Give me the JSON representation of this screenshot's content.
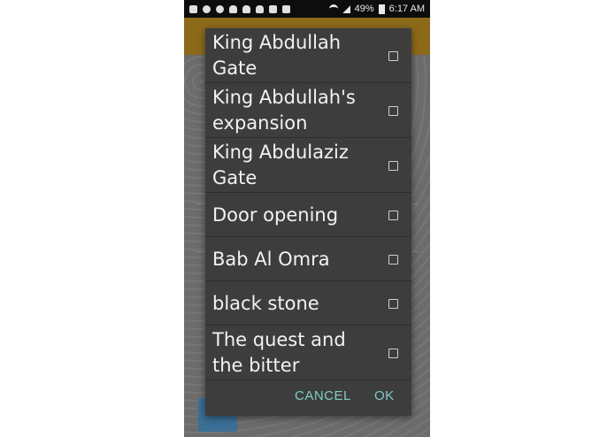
{
  "status_bar": {
    "icons": [
      "messaging-icon",
      "refresh-icon",
      "whatsapp-icon",
      "snapchat-icon",
      "snapchat-icon",
      "snapchat-icon",
      "image-icon",
      "clipboard-icon"
    ],
    "battery": "49%",
    "time": "6:17 AM"
  },
  "dialog": {
    "items": [
      {
        "label_lines": [
          "King Abdullah",
          "Gate"
        ],
        "checked": false
      },
      {
        "label_lines": [
          "King Abdullah's",
          "expansion"
        ],
        "checked": false
      },
      {
        "label_lines": [
          "King Abdulaziz",
          "Gate"
        ],
        "checked": false
      },
      {
        "label_lines": [
          "Door opening"
        ],
        "checked": false
      },
      {
        "label_lines": [
          "Bab Al Omra"
        ],
        "checked": false
      },
      {
        "label_lines": [
          "black stone"
        ],
        "checked": false
      },
      {
        "label_lines": [
          "The quest and",
          "the bitter"
        ],
        "checked": false
      }
    ],
    "cancel_label": "CANCEL",
    "ok_label": "OK"
  },
  "colors": {
    "dialog_bg": "#3d3d3d",
    "accent": "#80cbc4",
    "status_bar": "#0d0d0d",
    "toolbar": "#8c6a1a"
  }
}
